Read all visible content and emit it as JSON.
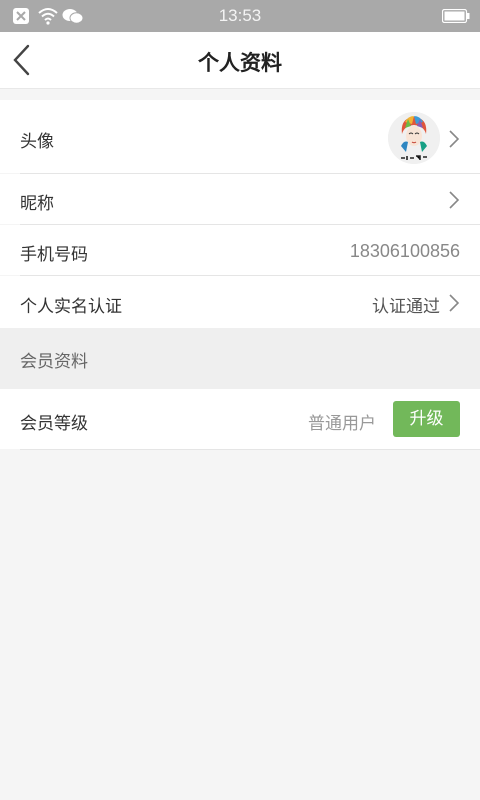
{
  "status_bar": {
    "time": "13:53"
  },
  "header": {
    "title": "个人资料"
  },
  "profile": {
    "avatar_label": "头像",
    "nickname_label": "昵称",
    "phone_label": "手机号码",
    "phone_value": "18306100856",
    "realname_label": "个人实名认证",
    "realname_value": "认证通过"
  },
  "member": {
    "section_title": "会员资料",
    "level_label": "会员等级",
    "level_value": "普通用户",
    "upgrade_label": "升级"
  },
  "colors": {
    "accent_green": "#72b85a",
    "status_bar": "#a9a9a9"
  }
}
